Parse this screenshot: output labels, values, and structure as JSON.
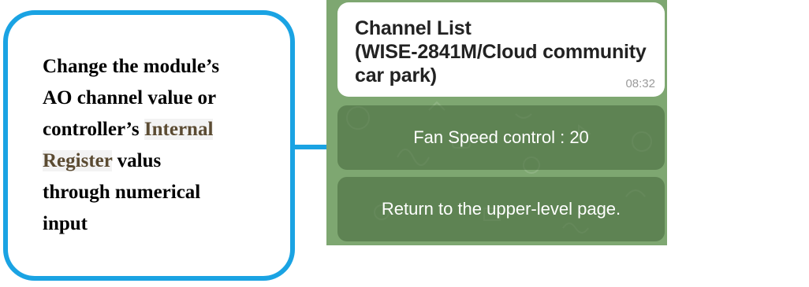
{
  "callout": {
    "line1": "Change the module’s",
    "line2": "AO channel value or",
    "line3_prefix": "controller’s ",
    "line3_highlight": "Internal",
    "line4_highlight": "Register",
    "line4_suffix": " valus",
    "line5": "through numerical",
    "line6": "input"
  },
  "chat": {
    "message": {
      "title_line1": "Channel List",
      "title_line2": "(WISE-2841M/Cloud community car park)",
      "time": "08:32"
    },
    "buttons": [
      {
        "label": "Fan Speed control : 20"
      },
      {
        "label": "Return to the upper-level page."
      }
    ]
  },
  "colors": {
    "callout_border": "#1aa3e3",
    "chat_background": "#7ea771",
    "button_background": "#5e8352"
  }
}
